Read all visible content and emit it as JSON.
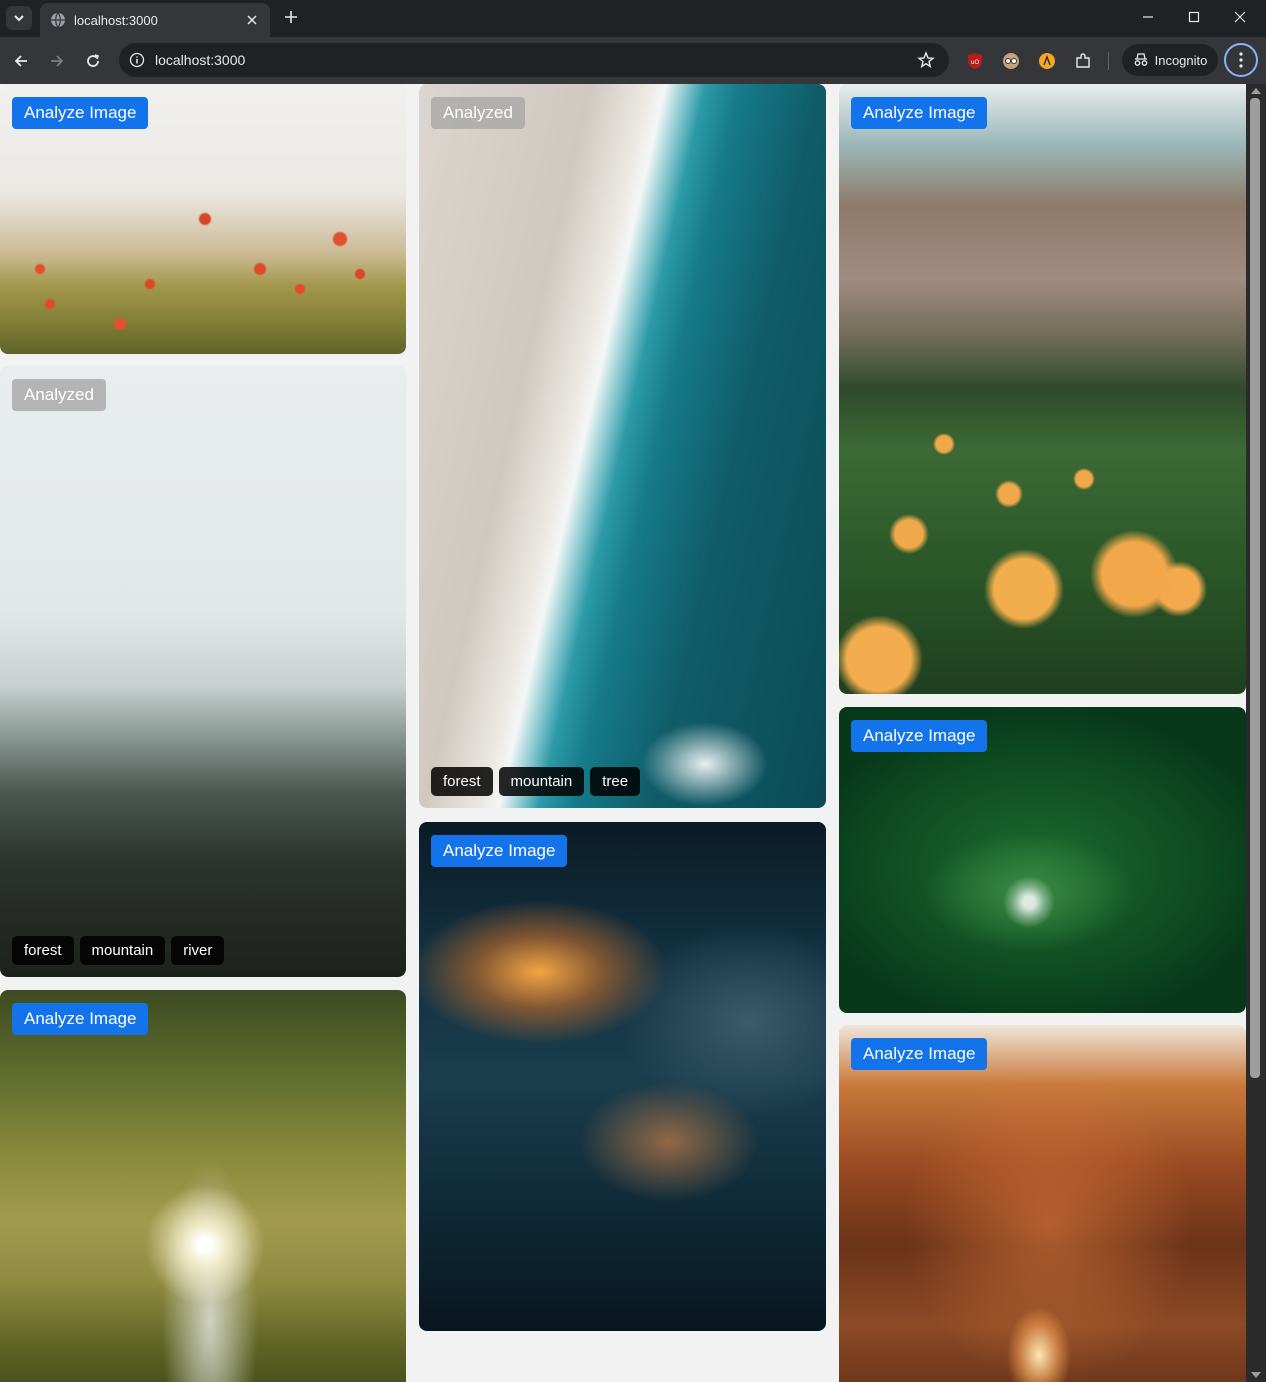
{
  "browser": {
    "tab_title": "localhost:3000",
    "url": "localhost:3000",
    "incognito_label": "Incognito"
  },
  "cards": [
    {
      "id": "poppies",
      "button": "Analyze Image",
      "analyzed": false,
      "tags": []
    },
    {
      "id": "fog-forest",
      "button": "Analyzed",
      "analyzed": true,
      "tags": [
        "forest",
        "mountain",
        "river"
      ]
    },
    {
      "id": "tree",
      "button": "Analyze Image",
      "analyzed": false,
      "tags": []
    },
    {
      "id": "ocean",
      "button": "Analyzed",
      "analyzed": true,
      "tags": [
        "forest",
        "mountain",
        "tree"
      ]
    },
    {
      "id": "clouds",
      "button": "Analyze Image",
      "analyzed": false,
      "tags": []
    },
    {
      "id": "mountain-meadow",
      "button": "Analyze Image",
      "analyzed": false,
      "tags": []
    },
    {
      "id": "leaf-drop",
      "button": "Analyze Image",
      "analyzed": false,
      "tags": []
    },
    {
      "id": "autumn-path",
      "button": "Analyze Image",
      "analyzed": false,
      "tags": []
    }
  ],
  "colors": {
    "analyze_button": "#1273ea",
    "analyzed_button": "#aaaaaa",
    "tag_background": "#000000"
  }
}
